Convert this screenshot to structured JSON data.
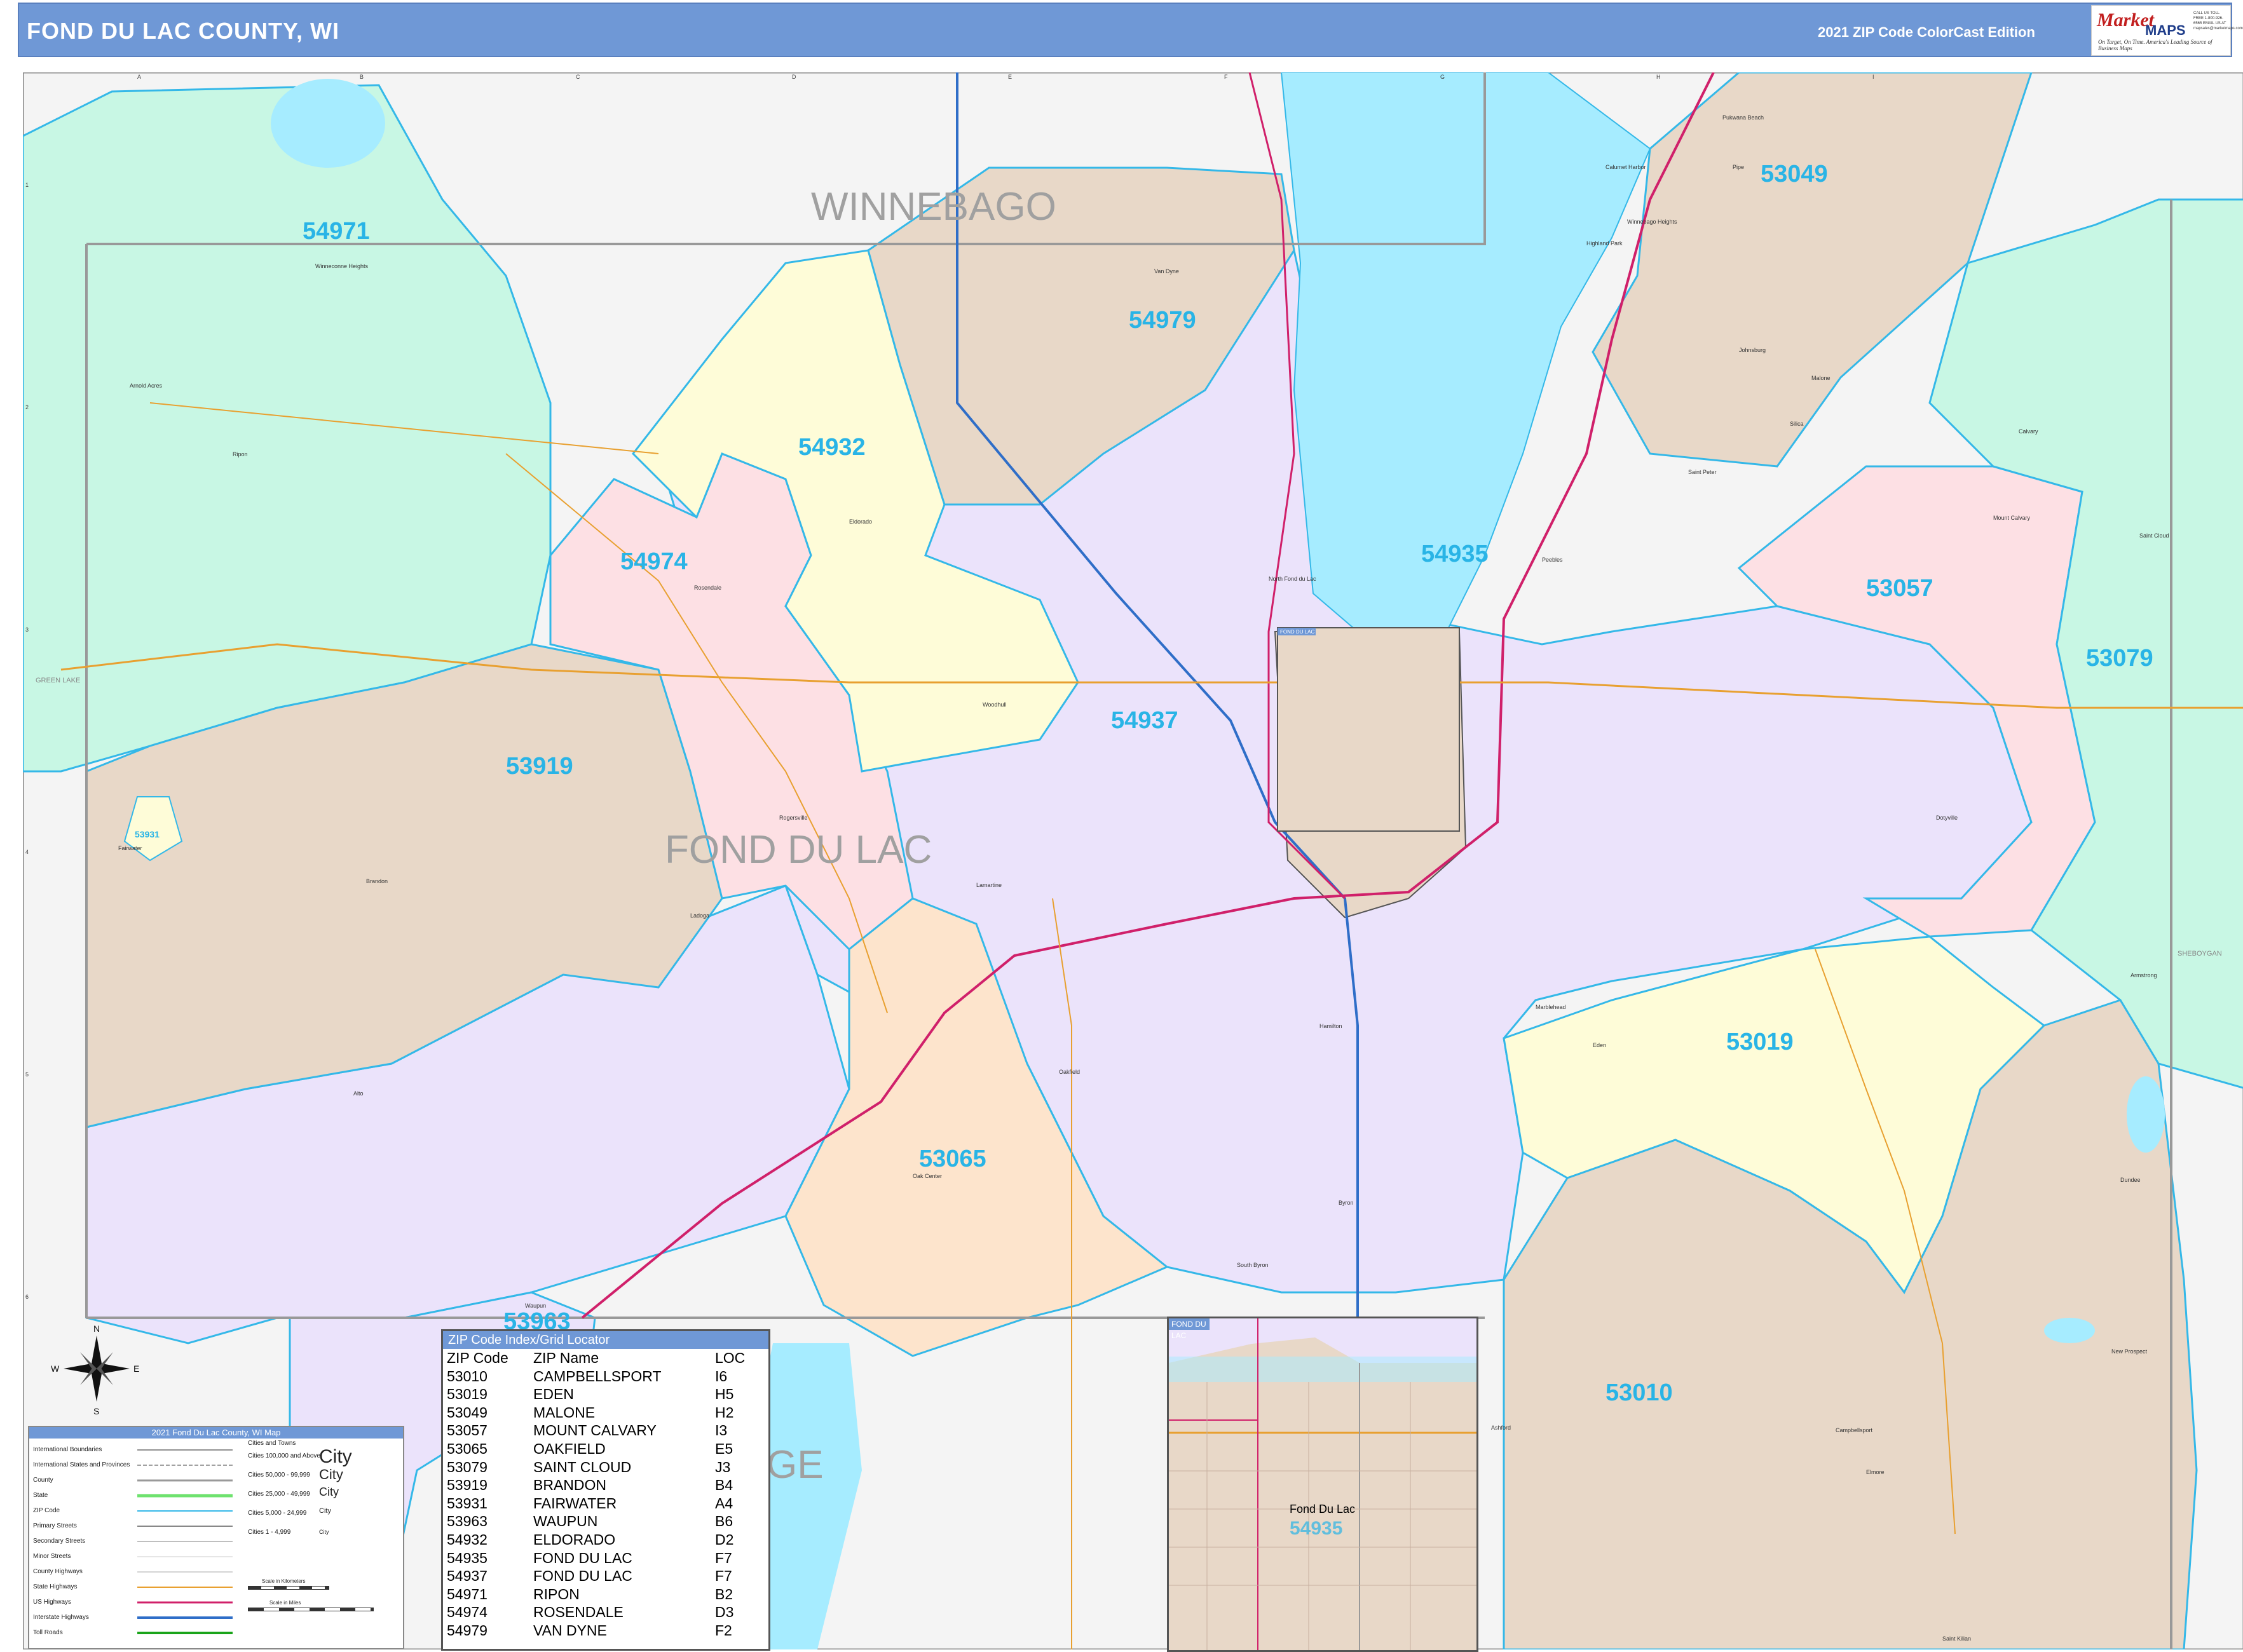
{
  "header": {
    "title": "FOND DU LAC COUNTY, WI",
    "edition": "2021 ZIP Code ColorCast Edition"
  },
  "logo": {
    "market": "Market",
    "maps": "MAPS",
    "tagline": "On Target, On Time. America's Leading Source of Business Maps",
    "contact": "CALL US TOLL FREE 1-800-926-6565  EMAIL US AT mapsales@marketmaps.com"
  },
  "grid": {
    "columns": [
      "A",
      "B",
      "C",
      "D",
      "E",
      "F",
      "G",
      "H",
      "I"
    ],
    "rows": [
      "1",
      "2",
      "3",
      "4",
      "5",
      "6"
    ]
  },
  "counties": {
    "winnebago": "WINNEBAGO",
    "fond_du_lac": "FOND DU LAC",
    "dodge_partial": "GE",
    "green_lake": "GREEN LAKE",
    "sheboygan": "SHEBOYGAN"
  },
  "zip_labels": [
    {
      "zip": "54971"
    },
    {
      "zip": "54979"
    },
    {
      "zip": "53049"
    },
    {
      "zip": "54932"
    },
    {
      "zip": "54935"
    },
    {
      "zip": "54974"
    },
    {
      "zip": "53057"
    },
    {
      "zip": "53079"
    },
    {
      "zip": "54937"
    },
    {
      "zip": "53919"
    },
    {
      "zip": "53931"
    },
    {
      "zip": "53019"
    },
    {
      "zip": "53065"
    },
    {
      "zip": "53963"
    },
    {
      "zip": "53010"
    }
  ],
  "places": [
    "Winneconne Heights",
    "Arnold Acres",
    "Ripon",
    "Van Dyne",
    "Eldorado",
    "North Fond du Lac",
    "Rosendale",
    "Woodhull",
    "Peebles",
    "Saint Peter",
    "Mount Calvary",
    "Saint Cloud",
    "Rogersville",
    "Brandon",
    "Fairwater",
    "Ladoga",
    "Lamartine",
    "Marblehead",
    "Eden",
    "Hamilton",
    "Johnsburg",
    "Malone",
    "Calvary",
    "Dotyville",
    "Armstrong",
    "Elmore",
    "Oakfield",
    "Alto",
    "Oak Center",
    "Byron",
    "South Byron",
    "Waupun",
    "Ashford",
    "Campbellsport",
    "New Prospect",
    "Dundee",
    "Saint Kilian",
    "Silica",
    "Calumet Harbor",
    "Pipe",
    "Highland Park",
    "Pukwana Beach",
    "Winnebago Heights"
  ],
  "inset_main": {
    "title": "FOND DU LAC"
  },
  "inset_bottom": {
    "title": "FOND DU LAC",
    "city": "Fond Du Lac",
    "zip": "54935"
  },
  "compass": {
    "n": "N",
    "s": "S",
    "e": "E",
    "w": "W"
  },
  "zip_index": {
    "title": "ZIP Code Index/Grid Locator",
    "headers": [
      "ZIP Code",
      "ZIP Name",
      "LOC"
    ],
    "rows": [
      [
        "53010",
        "CAMPBELLSPORT",
        "I6"
      ],
      [
        "53019",
        "EDEN",
        "H5"
      ],
      [
        "53049",
        "MALONE",
        "H2"
      ],
      [
        "53057",
        "MOUNT CALVARY",
        "I3"
      ],
      [
        "53065",
        "OAKFIELD",
        "E5"
      ],
      [
        "53079",
        "SAINT CLOUD",
        "J3"
      ],
      [
        "53919",
        "BRANDON",
        "B4"
      ],
      [
        "53931",
        "FAIRWATER",
        "A4"
      ],
      [
        "53963",
        "WAUPUN",
        "B6"
      ],
      [
        "54932",
        "ELDORADO",
        "D2"
      ],
      [
        "54935",
        "FOND DU LAC",
        "F7"
      ],
      [
        "54937",
        "FOND DU LAC",
        "F7"
      ],
      [
        "54971",
        "RIPON",
        "B2"
      ],
      [
        "54974",
        "ROSENDALE",
        "D3"
      ],
      [
        "54979",
        "VAN DYNE",
        "F2"
      ]
    ]
  },
  "legend": {
    "title": "2021 Fond Du Lac County, WI Map",
    "left_items": [
      "International Boundaries",
      "International States and Provinces",
      "County",
      "State",
      "ZIP Code",
      "Primary Streets",
      "Secondary Streets",
      "Minor Streets",
      "County Highways",
      "State Highways",
      "US Highways",
      "Interstate Highways",
      "Toll Roads"
    ],
    "cities_heading": "Cities and Towns",
    "city_items": [
      "Cities 100,000 and Above",
      "Cities 50,000 - 99,999",
      "Cities 25,000 - 49,999",
      "Cities 5,000 - 24,999",
      "Cities 1 - 4,999"
    ],
    "city_samples": [
      "City",
      "City",
      "City",
      "City",
      "City"
    ],
    "scale_km": "Scale in Kilometers",
    "scale_mi": "Scale in Miles"
  },
  "colors": {
    "header": "#6f98d6",
    "zip_label": "#29b4e6",
    "water": "#a6ecff",
    "mint": "#c8f7e4",
    "tan": "#e8d8c8",
    "lavender": "#ebe3fb",
    "pink": "#fde0e4",
    "yellow": "#fefcd8",
    "peach": "#fde4cc",
    "zip_border": "#34b8e8",
    "interstate": "#2f6ec8",
    "us_highway": "#d0206a",
    "state_highway": "#e8a030"
  }
}
